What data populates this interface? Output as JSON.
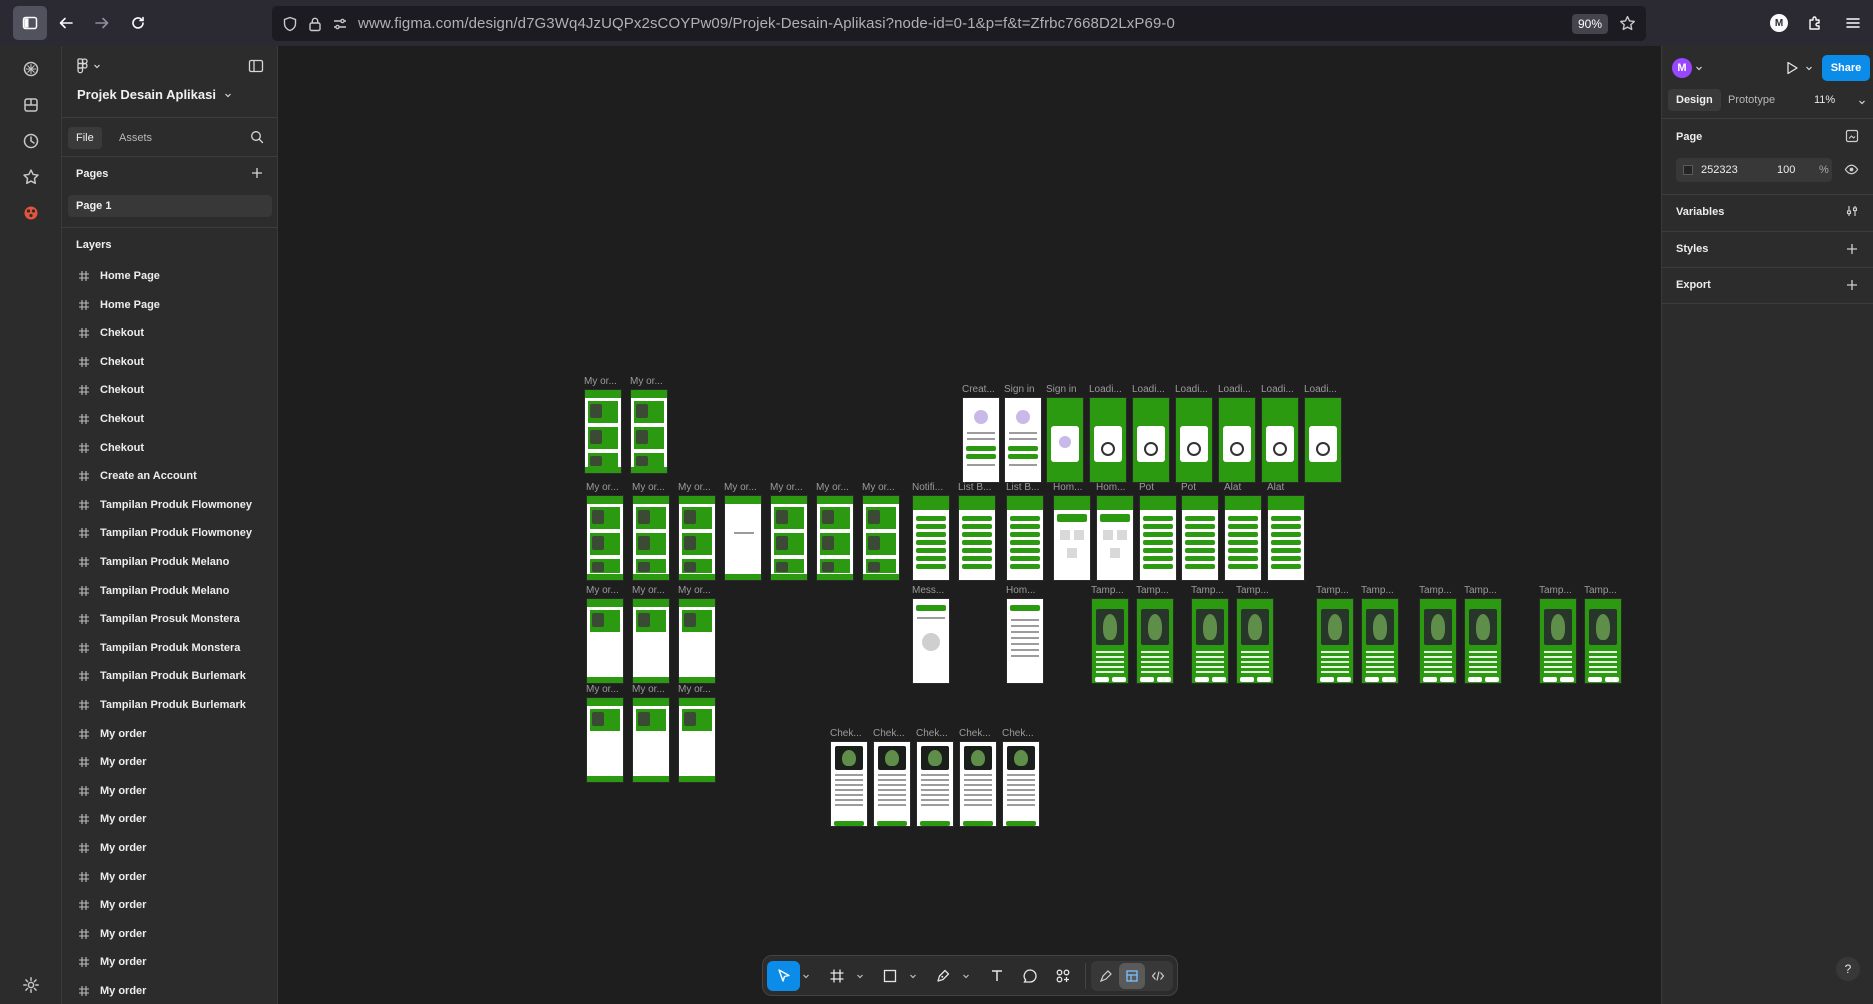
{
  "browser": {
    "url": "www.figma.com/design/d7G3Wq4JzUQPx2sCOYPw09/Projek-Desain-Aplikasi?node-id=0-1&p=f&t=Zfrbc7668D2LxP69-0",
    "zoom": "90%",
    "profile_initial": "M"
  },
  "file": {
    "name": "Projek Desain Aplikasi",
    "tabs": [
      "File",
      "Assets"
    ],
    "pages_heading": "Pages",
    "current_page": "Page 1",
    "layers_heading": "Layers",
    "layers": [
      "Home Page",
      "Home Page",
      "Chekout",
      "Chekout",
      "Chekout",
      "Chekout",
      "Chekout",
      "Create an Account",
      "Tampilan Produk Flowmoney",
      "Tampilan Produk Flowmoney",
      "Tampilan Produk Melano",
      "Tampilan Produk Melano",
      "Tampilan Prosuk Monstera",
      "Tampilan Produk Monstera",
      "Tampilan Produk Burlemark",
      "Tampilan Produk Burlemark",
      "My order",
      "My order",
      "My order",
      "My order",
      "My order",
      "My order",
      "My order",
      "My order",
      "My order",
      "My order"
    ]
  },
  "right_panel": {
    "avatar_initial": "M",
    "share_label": "Share",
    "tabs": [
      "Design",
      "Prototype"
    ],
    "zoom": "11%",
    "page_heading": "Page",
    "bg_color_hex": "252323",
    "bg_opacity": "100",
    "percent_sign": "%",
    "sections": [
      "Variables",
      "Styles",
      "Export"
    ]
  },
  "canvas_labels": {
    "my_order": "My or...",
    "create": "Creat...",
    "sign_in": "Sign in",
    "loading": "Loadi...",
    "notification": "Notifi...",
    "list": "List B...",
    "home": "Hom...",
    "pot": "Pot",
    "alat": "Alat",
    "message": "Mess...",
    "tampilan": "Tamp...",
    "chekout": "Chek..."
  },
  "help_label": "?"
}
